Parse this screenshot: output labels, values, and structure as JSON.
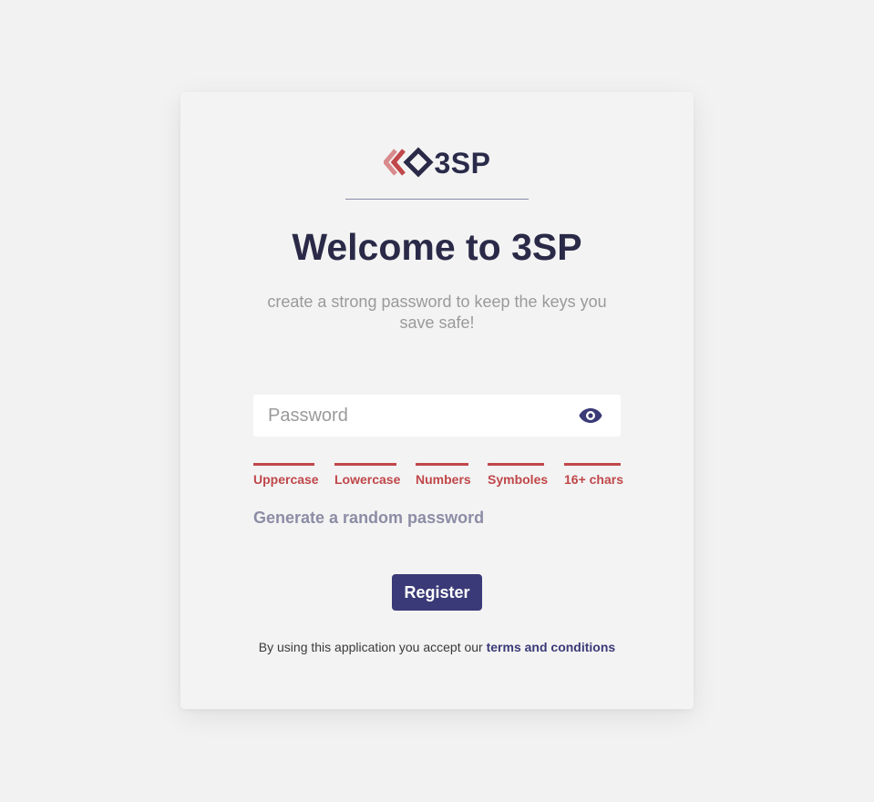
{
  "brand": {
    "name": "3SP",
    "logo_icon": "chevron-diamond-logo-icon",
    "colors": {
      "primary": "#3a3a78",
      "dark": "#2a2a48",
      "accent": "#c0474a",
      "accent_light": "#d98a8c"
    }
  },
  "header": {
    "title": "Welcome to 3SP",
    "subtitle": "create a strong password to keep the keys you save safe!"
  },
  "password_field": {
    "placeholder": "Password",
    "value": "",
    "toggle_icon": "eye-icon"
  },
  "requirements": [
    {
      "label": "Uppercase",
      "met": false
    },
    {
      "label": "Lowercase",
      "met": false
    },
    {
      "label": "Numbers",
      "met": false
    },
    {
      "label": "Symboles",
      "met": false
    },
    {
      "label": "16+ chars",
      "met": false
    }
  ],
  "generate_link": "Generate a random password",
  "register_button": "Register",
  "terms": {
    "prefix": "By using this application you accept our ",
    "link": "terms and conditions"
  }
}
